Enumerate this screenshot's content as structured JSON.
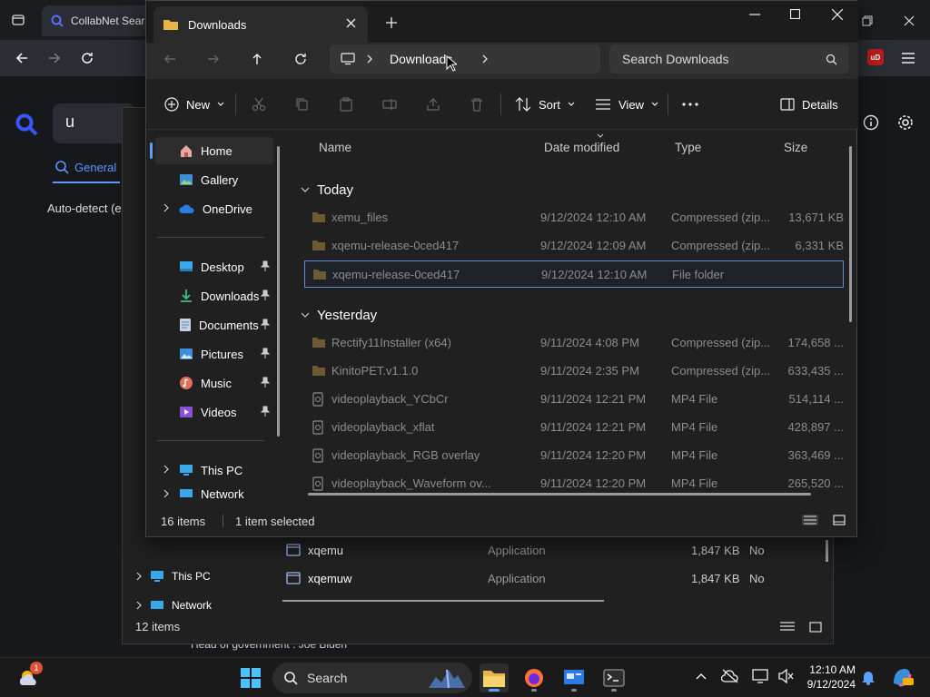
{
  "browser": {
    "tab_title": "CollabNet SearX",
    "search_value": "u",
    "tab_general": "General",
    "auto_detect": "Auto-detect (e",
    "footer_text": "Head of government : Joe Biden",
    "ublock_badge": "uD"
  },
  "explorer_bg": {
    "rows": [
      {
        "name": "xqemu",
        "type": "Application",
        "size": "1,847 KB",
        "compressed": "No"
      },
      {
        "name": "xqemuw",
        "type": "Application",
        "size": "1,847 KB",
        "compressed": "No"
      }
    ],
    "nav": [
      "This PC",
      "Network"
    ],
    "status": "12 items"
  },
  "explorer": {
    "tab_title": "Downloads",
    "address": "Downloads",
    "search_placeholder": "Search Downloads",
    "commands": {
      "new": "New",
      "sort": "Sort",
      "view": "View",
      "details": "Details"
    },
    "nav": {
      "home": "Home",
      "gallery": "Gallery",
      "onedrive": "OneDrive",
      "desktop": "Desktop",
      "downloads": "Downloads",
      "documents": "Documents",
      "pictures": "Pictures",
      "music": "Music",
      "videos": "Videos",
      "this_pc": "This PC",
      "network": "Network"
    },
    "columns": {
      "name": "Name",
      "date": "Date modified",
      "type": "Type",
      "size": "Size"
    },
    "groups": {
      "today": "Today",
      "yesterday": "Yesterday"
    },
    "today_files": [
      {
        "name": "xemu_files",
        "date": "9/12/2024 12:10 AM",
        "type": "Compressed (zip...",
        "size": "13,671 KB"
      },
      {
        "name": "xqemu-release-0ced417",
        "date": "9/12/2024 12:09 AM",
        "type": "Compressed (zip...",
        "size": "6,331 KB"
      },
      {
        "name": "xqemu-release-0ced417",
        "date": "9/12/2024 12:10 AM",
        "type": "File folder",
        "size": ""
      }
    ],
    "yesterday_files": [
      {
        "name": "Rectify11Installer (x64)",
        "date": "9/11/2024 4:08 PM",
        "type": "Compressed (zip...",
        "size": "174,658 ..."
      },
      {
        "name": "KinitoPET.v1.1.0",
        "date": "9/11/2024 2:35 PM",
        "type": "Compressed (zip...",
        "size": "633,435 ..."
      },
      {
        "name": "videoplayback_YCbCr",
        "date": "9/11/2024 12:21 PM",
        "type": "MP4 File",
        "size": "514,114 ..."
      },
      {
        "name": "videoplayback_xflat",
        "date": "9/11/2024 12:21 PM",
        "type": "MP4 File",
        "size": "428,897 ..."
      },
      {
        "name": "videoplayback_RGB overlay",
        "date": "9/11/2024 12:20 PM",
        "type": "MP4 File",
        "size": "363,469 ..."
      },
      {
        "name": "videoplayback_Waveform ov...",
        "date": "9/11/2024 12:20 PM",
        "type": "MP4 File",
        "size": "265,520 ..."
      }
    ],
    "status_count": "16 items",
    "status_selected": "1 item selected"
  },
  "taskbar": {
    "search": "Search",
    "time": "12:10 AM",
    "date": "9/12/2024",
    "weather_badge": "1"
  },
  "colors": {
    "accent": "#5e9eff",
    "folder": "#e8b44a",
    "selection": "#5b8fd8"
  }
}
